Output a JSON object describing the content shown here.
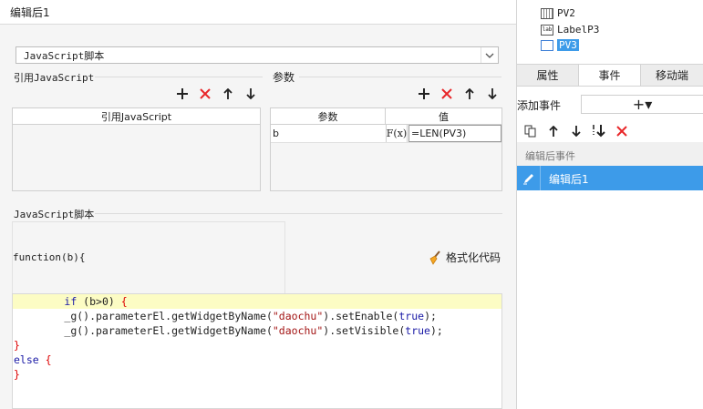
{
  "dialog": {
    "title": "编辑后1",
    "type_select": {
      "value": "JavaScript脚本",
      "arrow": "chevron-down-icon"
    },
    "ref_section": {
      "label": "引用JavaScript",
      "column": "引用JavaScript"
    },
    "param_section": {
      "label": "参数",
      "columns": [
        "参数",
        "值"
      ],
      "rows": [
        {
          "name": "b",
          "formula_icon": "F(x)",
          "value": "=LEN(PV3)"
        }
      ]
    },
    "script_section": {
      "label": "JavaScript脚本",
      "signature": "function(b){",
      "format_button": "格式化代码",
      "code": [
        {
          "indent": "        ",
          "parts": [
            {
              "t": "if ",
              "c": "kw"
            },
            {
              "t": "(b>0) "
            },
            {
              "t": "{",
              "c": "brace"
            }
          ],
          "highlight": true
        },
        {
          "indent": "        ",
          "parts": [
            {
              "t": "_g().parameterEl.getWidgetByName("
            },
            {
              "t": "\"daochu\"",
              "c": "str"
            },
            {
              "t": ").setEnable("
            },
            {
              "t": "true",
              "c": "kw"
            },
            {
              "t": ");"
            }
          ]
        },
        {
          "indent": "        ",
          "parts": [
            {
              "t": "_g().parameterEl.getWidgetByName("
            },
            {
              "t": "\"daochu\"",
              "c": "str"
            },
            {
              "t": ").setVisible("
            },
            {
              "t": "true",
              "c": "kw"
            },
            {
              "t": ");"
            }
          ]
        },
        {
          "indent": "",
          "parts": [
            {
              "t": "}",
              "c": "brace"
            }
          ]
        },
        {
          "indent": "",
          "parts": [
            {
              "t": "else ",
              "c": "kw"
            },
            {
              "t": "{",
              "c": "brace"
            }
          ]
        },
        {
          "indent": "",
          "parts": [
            {
              "t": "}",
              "c": "brace"
            }
          ]
        }
      ]
    },
    "toolbar": {
      "add": "+",
      "delete": "✕",
      "up": "↑",
      "down": "↓"
    }
  },
  "side_panel": {
    "tree": [
      {
        "label": "PV2",
        "icon": "calendar-widget-icon"
      },
      {
        "label": "LabelP3",
        "icon": "label-widget-icon"
      },
      {
        "label": "PV3",
        "icon": "combo-widget-icon",
        "selected": true
      }
    ],
    "tabs": [
      "属性",
      "事件",
      "移动端"
    ],
    "active_tab": "事件",
    "add_event_label": "添加事件",
    "add_event_button": "+▾",
    "event_group": "编辑后事件",
    "selected_event": "编辑后1"
  },
  "colors": {
    "accent": "#3d9be9",
    "delete": "#e8272a",
    "highlight": "#fcfcc4"
  }
}
